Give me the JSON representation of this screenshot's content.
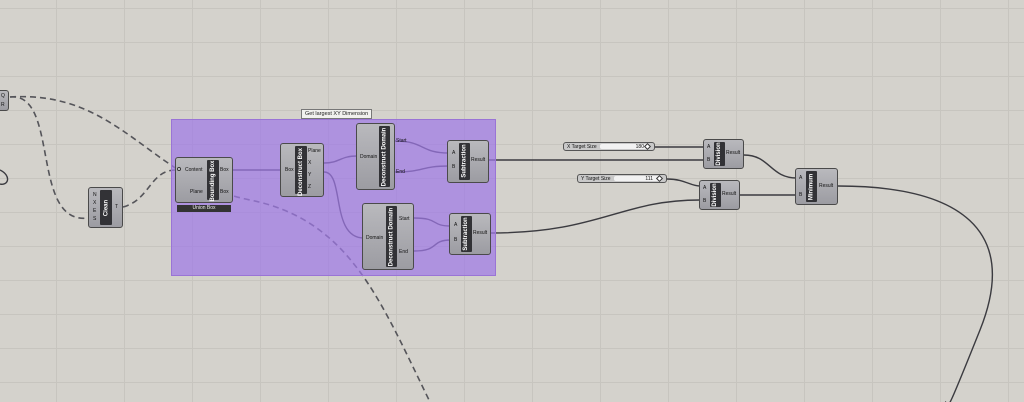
{
  "group": {
    "title": "Get largest XY Dimension"
  },
  "clean": {
    "title": "Clean",
    "inputs": [
      "N",
      "X",
      "E",
      "S"
    ],
    "output": "T"
  },
  "bounding_box": {
    "title": "Bounding Box",
    "inputs": [
      "Content",
      "Plane"
    ],
    "outputs": [
      "Box",
      "Box"
    ],
    "mode": "Union Box"
  },
  "deconstruct_box": {
    "title": "Deconstruct Box",
    "input": "Box",
    "outputs": [
      "Plane",
      "X",
      "Y",
      "Z"
    ]
  },
  "deconstruct_domain_1": {
    "title": "Deconstruct Domain",
    "input": "Domain",
    "outputs": [
      "Start",
      "End"
    ]
  },
  "deconstruct_domain_2": {
    "title": "Deconstruct Domain",
    "input": "Domain",
    "outputs": [
      "Start",
      "End"
    ]
  },
  "subtraction_1": {
    "title": "Subtraction",
    "inputs": [
      "A",
      "B"
    ],
    "output": "Result"
  },
  "subtraction_2": {
    "title": "Subtraction",
    "inputs": [
      "A",
      "B"
    ],
    "output": "Result"
  },
  "slider_x": {
    "name": "X Target Size",
    "value": "180"
  },
  "slider_y": {
    "name": "Y Target Size",
    "value": "111"
  },
  "division_1": {
    "title": "Division",
    "inputs": [
      "A",
      "B"
    ],
    "output": "Result"
  },
  "division_2": {
    "title": "Division",
    "inputs": [
      "A",
      "B"
    ],
    "output": "Result"
  },
  "minimum": {
    "title": "Minimum",
    "inputs": [
      "A",
      "B"
    ],
    "output": "Result"
  },
  "left_stub": {
    "pins": [
      "Q",
      "R"
    ]
  }
}
